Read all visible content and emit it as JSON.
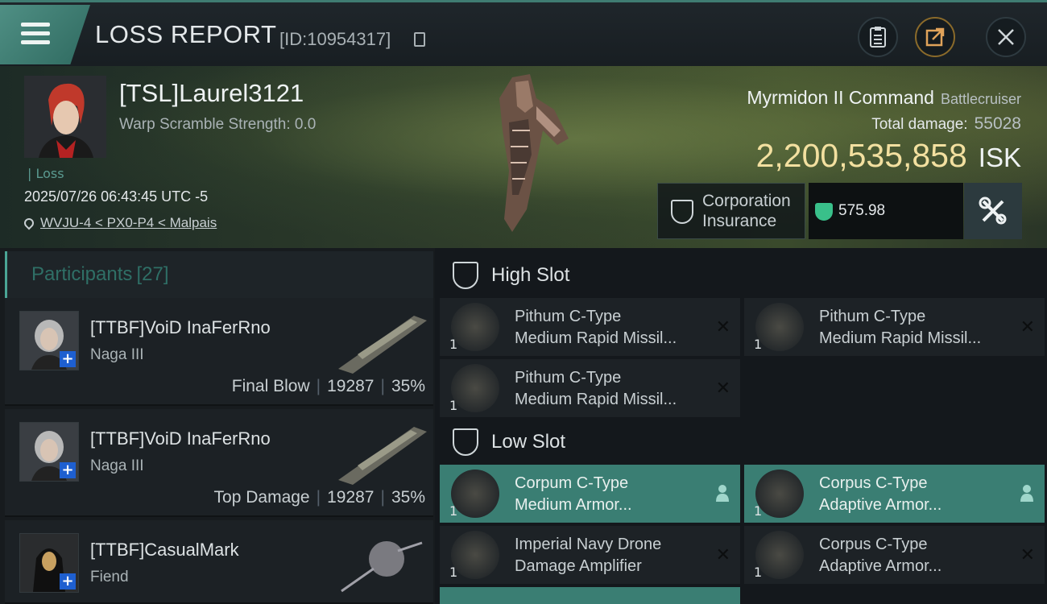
{
  "topbar": {
    "title": "LOSS REPORT",
    "report_id": "[ID:10954317]",
    "icons": [
      "menu-icon",
      "copy-icon",
      "clipboard-icon",
      "share-icon",
      "close-icon"
    ]
  },
  "victim": {
    "name": "[TSL]Laurel3121",
    "warp_scramble": "Warp Scramble Strength: 0.0",
    "loss_tag": "Loss",
    "datetime": "2025/07/26 06:43:45 UTC -5",
    "location": "WVJU-4 < PX0-P4 < Malpais"
  },
  "ship": {
    "name": "Myrmidon II Command",
    "class": "Battlecruiser",
    "total_damage_label": "Total damage:",
    "total_damage": "55028",
    "isk_value": "2,200,535,858",
    "isk_unit": "ISK"
  },
  "insurance": {
    "label_line1": "Corporation",
    "label_line2": "Insurance",
    "value": "575.98"
  },
  "participants": {
    "heading": "Participants",
    "count": "[27]",
    "items": [
      {
        "name": "[TTBF]VoiD InaFerRno",
        "ship": "Naga III",
        "role": "Final Blow",
        "damage": "19287",
        "percent": "35%"
      },
      {
        "name": "[TTBF]VoiD InaFerRno",
        "ship": "Naga III",
        "role": "Top Damage",
        "damage": "19287",
        "percent": "35%"
      },
      {
        "name": "[TTBF]CasualMark",
        "ship": "Fiend",
        "role": "",
        "damage": "",
        "percent": ""
      }
    ]
  },
  "slots": {
    "high": {
      "label": "High Slot",
      "modules": [
        {
          "line1": "Pithum C-Type",
          "line2": "Medium Rapid Missil...",
          "qty": "1"
        },
        {
          "line1": "Pithum C-Type",
          "line2": "Medium Rapid Missil...",
          "qty": "1"
        },
        {
          "line1": "Pithum C-Type",
          "line2": "Medium Rapid Missil...",
          "qty": "1"
        }
      ]
    },
    "low": {
      "label": "Low Slot",
      "modules": [
        {
          "line1": "Corpum C-Type",
          "line2": "Medium Armor...",
          "qty": "1"
        },
        {
          "line1": "Corpus C-Type",
          "line2": "Adaptive Armor...",
          "qty": "1"
        },
        {
          "line1": "Imperial Navy Drone",
          "line2": "Damage Amplifier",
          "qty": "1"
        },
        {
          "line1": "Corpus C-Type",
          "line2": "Adaptive Armor...",
          "qty": "1"
        }
      ]
    }
  },
  "colors": {
    "accent": "#3a7e73",
    "isk": "#f3e0a0",
    "insurance_icon": "#39c08a"
  }
}
